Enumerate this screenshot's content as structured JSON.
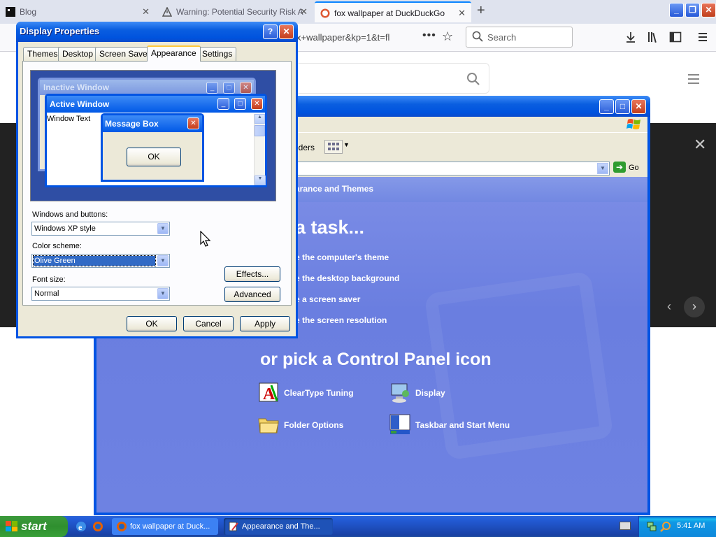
{
  "firefox": {
    "tabs": [
      {
        "title": "Blog",
        "active": false
      },
      {
        "title": "Warning: Potential Security Risk A",
        "active": false
      },
      {
        "title": "fox wallpaper at DuckDuckGo",
        "active": true
      }
    ],
    "url_fragment": "x+wallpaper&kp=1&t=fl",
    "search_placeholder": "Search",
    "tab_close": "✕",
    "new_tab": "+",
    "overflow": "•••",
    "bookmark_star": "☆"
  },
  "ddg": {
    "close": "✕",
    "prev": "‹",
    "next": "›"
  },
  "control_panel": {
    "toolbar_folders": "lders",
    "address_go": "Go",
    "header": "arance and Themes",
    "pick_task": "a task...",
    "tasks": [
      "e the computer's theme",
      "e the desktop background",
      "e a screen saver",
      "e the screen resolution"
    ],
    "or_pick": "or pick a Control Panel icon",
    "icons": [
      {
        "label": "ClearType Tuning"
      },
      {
        "label": "Display"
      },
      {
        "label": "Folder Options"
      },
      {
        "label": "Taskbar and Start Menu"
      }
    ]
  },
  "display_properties": {
    "title": "Display Properties",
    "tabs": [
      "Themes",
      "Desktop",
      "Screen Saver",
      "Appearance",
      "Settings"
    ],
    "selected_tab": "Appearance",
    "preview": {
      "inactive_title": "Inactive Window",
      "active_title": "Active Window",
      "window_text": "Window Text",
      "message_box_title": "Message Box",
      "message_ok": "OK"
    },
    "windows_buttons_label": "Windows and buttons:",
    "windows_buttons_value": "Windows XP style",
    "color_scheme_label": "Color scheme:",
    "color_scheme_value": "Olive Green",
    "font_size_label": "Font size:",
    "font_size_value": "Normal",
    "effects_button": "Effects...",
    "advanced_button": "Advanced",
    "ok_button": "OK",
    "cancel_button": "Cancel",
    "apply_button": "Apply"
  },
  "taskbar": {
    "start_label": "start",
    "buttons": [
      {
        "label": "fox wallpaper at Duck...",
        "active": false
      },
      {
        "label": "Appearance and The...",
        "active": true
      }
    ],
    "clock": "5:41 AM"
  },
  "colors": {
    "xp_blue": "#0054e3",
    "dialog_bg": "#ece9d8",
    "cp_content": "#7288e2",
    "start_green": "#2f8f2f"
  }
}
